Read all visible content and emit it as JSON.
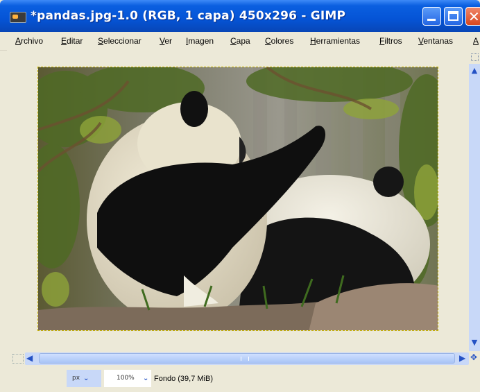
{
  "window": {
    "title": "*pandas.jpg-1.0 (RGB, 1 capa) 450x296 - GIMP"
  },
  "menu": [
    {
      "label": "Archivo",
      "u": "A",
      "rest": "rchivo"
    },
    {
      "label": "Editar",
      "u": "E",
      "rest": "ditar"
    },
    {
      "label": "Seleccionar",
      "u": "S",
      "rest": "eleccionar"
    },
    {
      "label": "Ver",
      "u": "V",
      "rest": "er"
    },
    {
      "label": "Imagen",
      "u": "I",
      "rest": "magen"
    },
    {
      "label": "Capa",
      "u": "C",
      "rest": "apa"
    },
    {
      "label": "Colores",
      "u": "C",
      "rest": "olores"
    },
    {
      "label": "Herramientas",
      "u": "H",
      "rest": "erramientas"
    },
    {
      "label": "Filtros",
      "u": "F",
      "rest": "iltros"
    },
    {
      "label": "Ventanas",
      "u": "V",
      "rest": "entanas"
    },
    {
      "label": "A",
      "u": "A",
      "rest": ""
    }
  ],
  "status": {
    "unit": "px",
    "zoom": "100%",
    "layer_info": "Fondo (39,7 MiB)"
  },
  "icons": {
    "scroll_up": "chevron-up-icon",
    "scroll_down": "chevron-down-icon",
    "scroll_left": "chevron-left-icon",
    "scroll_right": "chevron-right-icon"
  },
  "colors": {
    "titlebar": "#0554d6",
    "selection_border": "#c7b200",
    "scrollbar": "#c8d8f8"
  }
}
